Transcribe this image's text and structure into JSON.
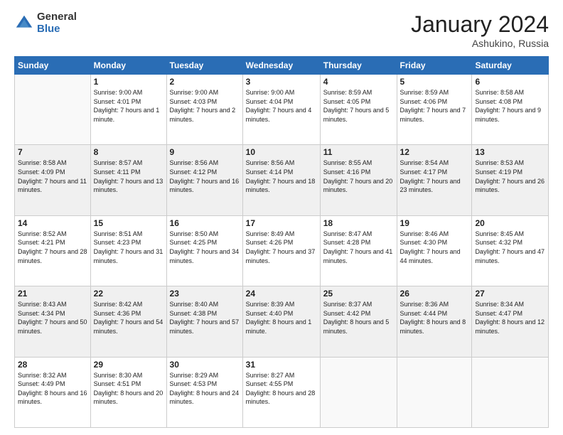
{
  "logo": {
    "general": "General",
    "blue": "Blue"
  },
  "header": {
    "month": "January 2024",
    "location": "Ashukino, Russia"
  },
  "weekdays": [
    "Sunday",
    "Monday",
    "Tuesday",
    "Wednesday",
    "Thursday",
    "Friday",
    "Saturday"
  ],
  "weeks": [
    [
      {
        "day": "",
        "sunrise": "",
        "sunset": "",
        "daylight": ""
      },
      {
        "day": "1",
        "sunrise": "Sunrise: 9:00 AM",
        "sunset": "Sunset: 4:01 PM",
        "daylight": "Daylight: 7 hours and 1 minute."
      },
      {
        "day": "2",
        "sunrise": "Sunrise: 9:00 AM",
        "sunset": "Sunset: 4:03 PM",
        "daylight": "Daylight: 7 hours and 2 minutes."
      },
      {
        "day": "3",
        "sunrise": "Sunrise: 9:00 AM",
        "sunset": "Sunset: 4:04 PM",
        "daylight": "Daylight: 7 hours and 4 minutes."
      },
      {
        "day": "4",
        "sunrise": "Sunrise: 8:59 AM",
        "sunset": "Sunset: 4:05 PM",
        "daylight": "Daylight: 7 hours and 5 minutes."
      },
      {
        "day": "5",
        "sunrise": "Sunrise: 8:59 AM",
        "sunset": "Sunset: 4:06 PM",
        "daylight": "Daylight: 7 hours and 7 minutes."
      },
      {
        "day": "6",
        "sunrise": "Sunrise: 8:58 AM",
        "sunset": "Sunset: 4:08 PM",
        "daylight": "Daylight: 7 hours and 9 minutes."
      }
    ],
    [
      {
        "day": "7",
        "sunrise": "Sunrise: 8:58 AM",
        "sunset": "Sunset: 4:09 PM",
        "daylight": "Daylight: 7 hours and 11 minutes."
      },
      {
        "day": "8",
        "sunrise": "Sunrise: 8:57 AM",
        "sunset": "Sunset: 4:11 PM",
        "daylight": "Daylight: 7 hours and 13 minutes."
      },
      {
        "day": "9",
        "sunrise": "Sunrise: 8:56 AM",
        "sunset": "Sunset: 4:12 PM",
        "daylight": "Daylight: 7 hours and 16 minutes."
      },
      {
        "day": "10",
        "sunrise": "Sunrise: 8:56 AM",
        "sunset": "Sunset: 4:14 PM",
        "daylight": "Daylight: 7 hours and 18 minutes."
      },
      {
        "day": "11",
        "sunrise": "Sunrise: 8:55 AM",
        "sunset": "Sunset: 4:16 PM",
        "daylight": "Daylight: 7 hours and 20 minutes."
      },
      {
        "day": "12",
        "sunrise": "Sunrise: 8:54 AM",
        "sunset": "Sunset: 4:17 PM",
        "daylight": "Daylight: 7 hours and 23 minutes."
      },
      {
        "day": "13",
        "sunrise": "Sunrise: 8:53 AM",
        "sunset": "Sunset: 4:19 PM",
        "daylight": "Daylight: 7 hours and 26 minutes."
      }
    ],
    [
      {
        "day": "14",
        "sunrise": "Sunrise: 8:52 AM",
        "sunset": "Sunset: 4:21 PM",
        "daylight": "Daylight: 7 hours and 28 minutes."
      },
      {
        "day": "15",
        "sunrise": "Sunrise: 8:51 AM",
        "sunset": "Sunset: 4:23 PM",
        "daylight": "Daylight: 7 hours and 31 minutes."
      },
      {
        "day": "16",
        "sunrise": "Sunrise: 8:50 AM",
        "sunset": "Sunset: 4:25 PM",
        "daylight": "Daylight: 7 hours and 34 minutes."
      },
      {
        "day": "17",
        "sunrise": "Sunrise: 8:49 AM",
        "sunset": "Sunset: 4:26 PM",
        "daylight": "Daylight: 7 hours and 37 minutes."
      },
      {
        "day": "18",
        "sunrise": "Sunrise: 8:47 AM",
        "sunset": "Sunset: 4:28 PM",
        "daylight": "Daylight: 7 hours and 41 minutes."
      },
      {
        "day": "19",
        "sunrise": "Sunrise: 8:46 AM",
        "sunset": "Sunset: 4:30 PM",
        "daylight": "Daylight: 7 hours and 44 minutes."
      },
      {
        "day": "20",
        "sunrise": "Sunrise: 8:45 AM",
        "sunset": "Sunset: 4:32 PM",
        "daylight": "Daylight: 7 hours and 47 minutes."
      }
    ],
    [
      {
        "day": "21",
        "sunrise": "Sunrise: 8:43 AM",
        "sunset": "Sunset: 4:34 PM",
        "daylight": "Daylight: 7 hours and 50 minutes."
      },
      {
        "day": "22",
        "sunrise": "Sunrise: 8:42 AM",
        "sunset": "Sunset: 4:36 PM",
        "daylight": "Daylight: 7 hours and 54 minutes."
      },
      {
        "day": "23",
        "sunrise": "Sunrise: 8:40 AM",
        "sunset": "Sunset: 4:38 PM",
        "daylight": "Daylight: 7 hours and 57 minutes."
      },
      {
        "day": "24",
        "sunrise": "Sunrise: 8:39 AM",
        "sunset": "Sunset: 4:40 PM",
        "daylight": "Daylight: 8 hours and 1 minute."
      },
      {
        "day": "25",
        "sunrise": "Sunrise: 8:37 AM",
        "sunset": "Sunset: 4:42 PM",
        "daylight": "Daylight: 8 hours and 5 minutes."
      },
      {
        "day": "26",
        "sunrise": "Sunrise: 8:36 AM",
        "sunset": "Sunset: 4:44 PM",
        "daylight": "Daylight: 8 hours and 8 minutes."
      },
      {
        "day": "27",
        "sunrise": "Sunrise: 8:34 AM",
        "sunset": "Sunset: 4:47 PM",
        "daylight": "Daylight: 8 hours and 12 minutes."
      }
    ],
    [
      {
        "day": "28",
        "sunrise": "Sunrise: 8:32 AM",
        "sunset": "Sunset: 4:49 PM",
        "daylight": "Daylight: 8 hours and 16 minutes."
      },
      {
        "day": "29",
        "sunrise": "Sunrise: 8:30 AM",
        "sunset": "Sunset: 4:51 PM",
        "daylight": "Daylight: 8 hours and 20 minutes."
      },
      {
        "day": "30",
        "sunrise": "Sunrise: 8:29 AM",
        "sunset": "Sunset: 4:53 PM",
        "daylight": "Daylight: 8 hours and 24 minutes."
      },
      {
        "day": "31",
        "sunrise": "Sunrise: 8:27 AM",
        "sunset": "Sunset: 4:55 PM",
        "daylight": "Daylight: 8 hours and 28 minutes."
      },
      {
        "day": "",
        "sunrise": "",
        "sunset": "",
        "daylight": ""
      },
      {
        "day": "",
        "sunrise": "",
        "sunset": "",
        "daylight": ""
      },
      {
        "day": "",
        "sunrise": "",
        "sunset": "",
        "daylight": ""
      }
    ]
  ]
}
